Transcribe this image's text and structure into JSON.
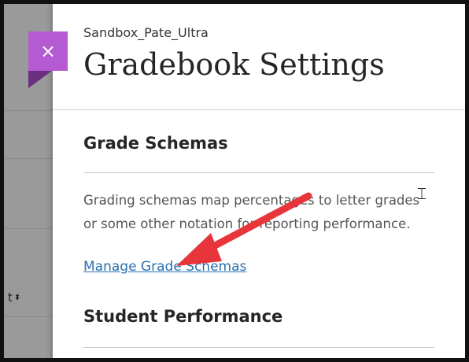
{
  "background": {
    "column_text": "t",
    "sort_icon": "sort-icon"
  },
  "panel": {
    "course_name": "Sandbox_Pate_Ultra",
    "title": "Gradebook Settings",
    "close_label": "×"
  },
  "sections": {
    "grade_schemas": {
      "heading": "Grade Schemas",
      "description": "Grading schemas map percentages to letter grades or some other notation for reporting performance.",
      "link": "Manage Grade Schemas"
    },
    "student_performance": {
      "heading": "Student Performance"
    }
  },
  "cursor_icon": "text-cursor-icon",
  "annotation": {
    "arrow_color": "#e8353b"
  },
  "colors": {
    "accent": "#b45ad2",
    "link": "#2a6fb0"
  }
}
